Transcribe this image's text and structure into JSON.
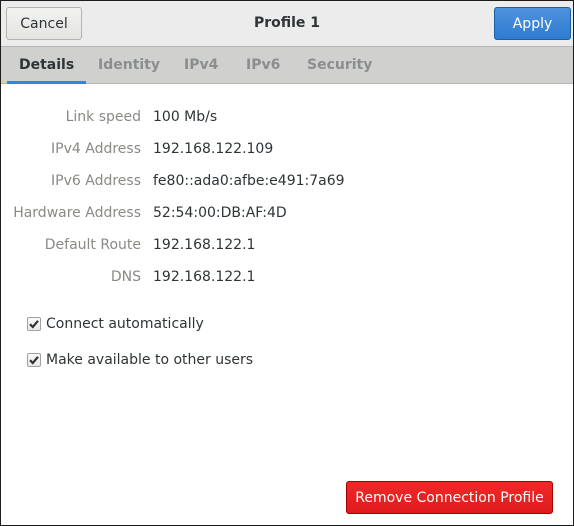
{
  "header": {
    "title": "Profile 1",
    "cancel_label": "Cancel",
    "apply_label": "Apply"
  },
  "tabs": [
    {
      "label": "Details",
      "active": true
    },
    {
      "label": "Identity",
      "active": false
    },
    {
      "label": "IPv4",
      "active": false
    },
    {
      "label": "IPv6",
      "active": false
    },
    {
      "label": "Security",
      "active": false
    }
  ],
  "details": [
    {
      "label": "Link speed",
      "value": "100 Mb/s"
    },
    {
      "label": "IPv4 Address",
      "value": "192.168.122.109"
    },
    {
      "label": "IPv6 Address",
      "value": "fe80::ada0:afbe:e491:7a69"
    },
    {
      "label": "Hardware Address",
      "value": "52:54:00:DB:AF:4D"
    },
    {
      "label": "Default Route",
      "value": "192.168.122.1"
    },
    {
      "label": "DNS",
      "value": "192.168.122.1"
    }
  ],
  "options": [
    {
      "label": "Connect automatically",
      "checked": true
    },
    {
      "label": "Make available to other users",
      "checked": true
    }
  ],
  "remove_label": "Remove Connection Profile",
  "colors": {
    "accent": "#3584e4",
    "apply": "#3b86d6",
    "destructive": "#e51c1c"
  }
}
